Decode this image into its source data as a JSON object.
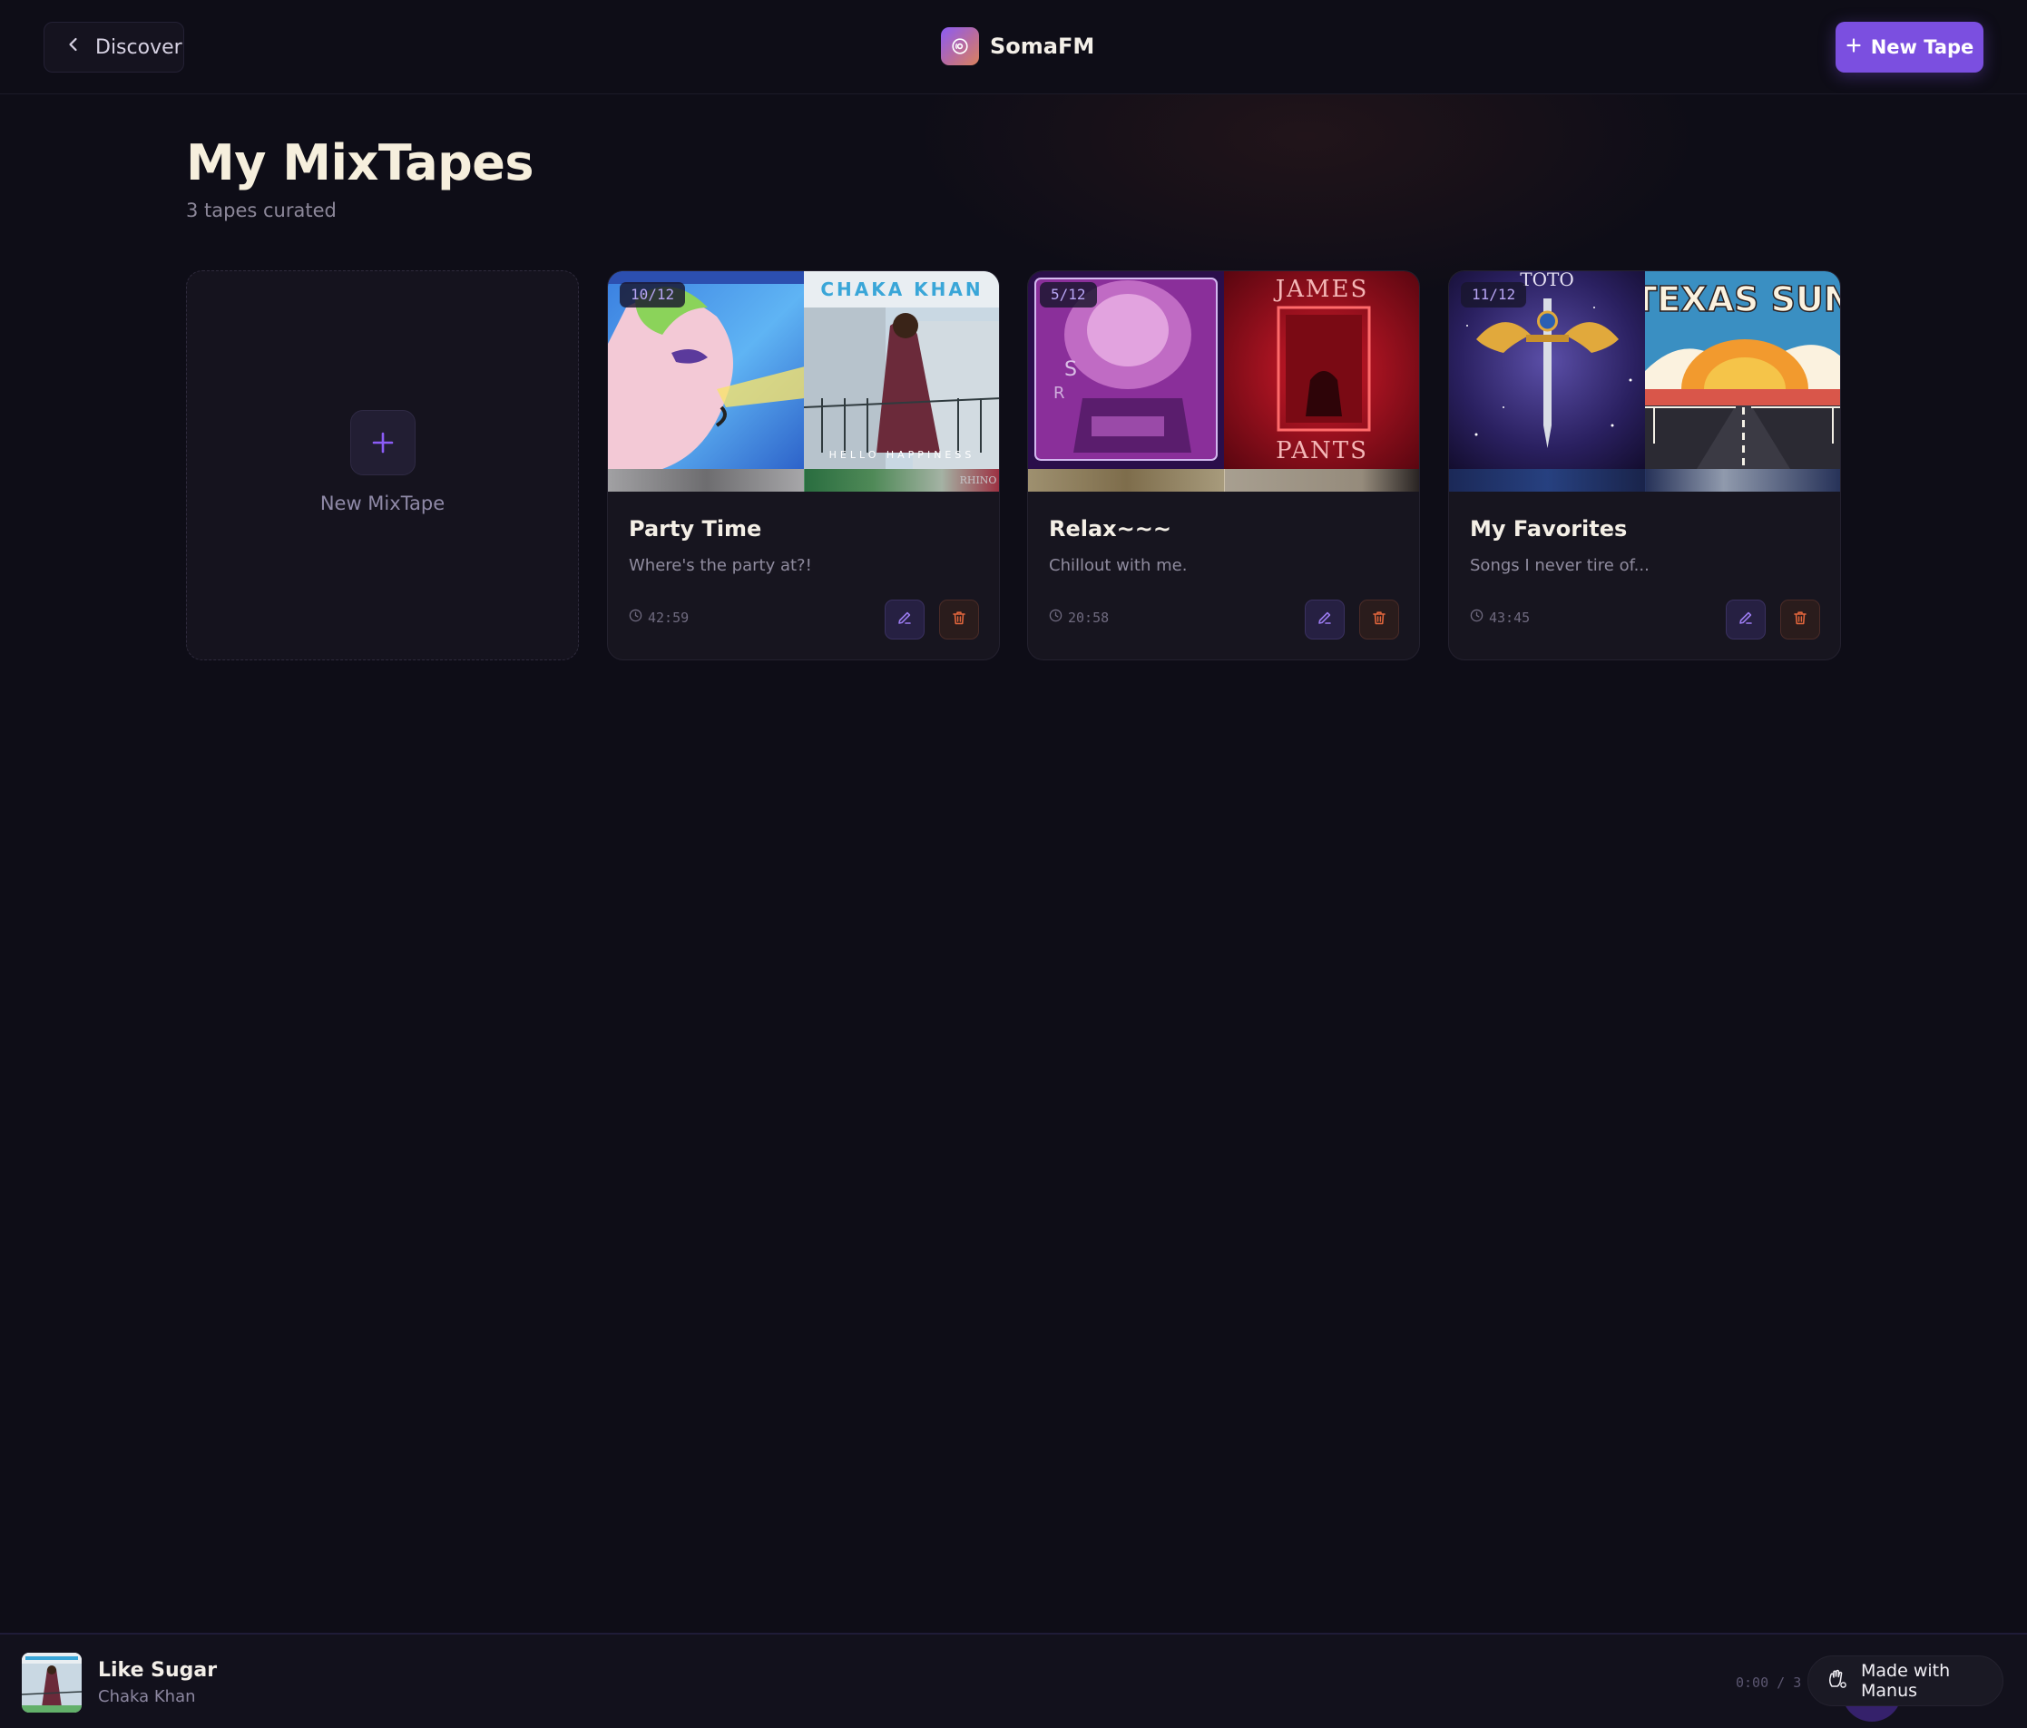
{
  "header": {
    "back_label": "Discover",
    "brand_name": "SomaFM",
    "new_tape_label": "New Tape"
  },
  "page": {
    "title": "My MixTapes",
    "subtitle": "3 tapes curated"
  },
  "new_card": {
    "label": "New MixTape"
  },
  "tapes": [
    {
      "title": "Party Time",
      "description": "Where's the party at?!",
      "count": "10/12",
      "duration": "42:59"
    },
    {
      "title": "Relax~~~",
      "description": "Chillout with me.",
      "count": "5/12",
      "duration": "20:58"
    },
    {
      "title": "My Favorites",
      "description": "Songs I never tire of...",
      "count": "11/12",
      "duration": "43:45"
    }
  ],
  "covers": {
    "tape0_right_title": "CHAKA KHAN",
    "tape0_right_caption": "HELLO HAPPINESS",
    "tape0_right_label": "RHINO",
    "tape1_right_title": "JAMES",
    "tape1_right_caption": "PANTS",
    "tape2_left_title": "TOTO",
    "tape2_right_title": "TEXAS SUN"
  },
  "player": {
    "track_title": "Like Sugar",
    "track_artist": "Chaka Khan",
    "time": "0:00 / 3"
  },
  "badge": {
    "label": "Made with Manus"
  },
  "colors": {
    "background": "#0e0d17",
    "accent": "#7b4fe0",
    "title": "#f6efdd",
    "danger": "#e0653c"
  },
  "icons": {
    "back": "chevron-left-icon",
    "brand": "radio-icon",
    "new_tape": "plus-icon",
    "duration": "clock-icon",
    "edit": "pencil-icon",
    "delete": "trash-icon",
    "badge": "manus-hand-icon"
  }
}
